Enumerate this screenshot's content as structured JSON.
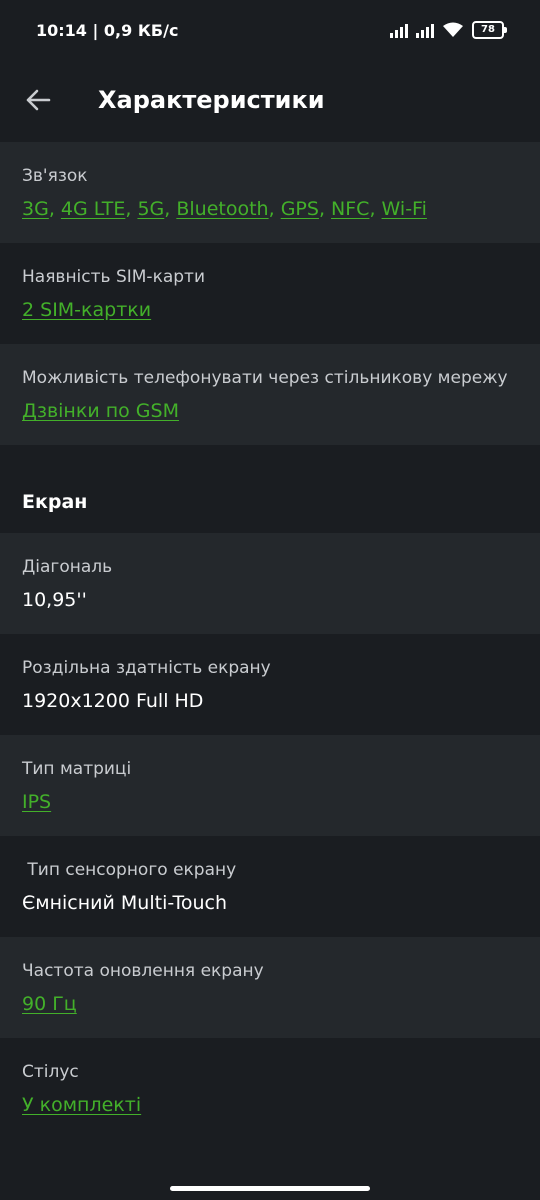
{
  "status_bar": {
    "time_speed": "10:14 | 0,9 КБ/с",
    "battery": "78"
  },
  "header": {
    "title": "Характеристики"
  },
  "connection": {
    "label": "Зв'язок",
    "links": [
      "3G",
      "4G LTE",
      "5G",
      "Bluetooth",
      "GPS",
      "NFC",
      "Wi-Fi"
    ]
  },
  "sim": {
    "label": "Наявність SIM-карти",
    "value": "2 SIM-картки"
  },
  "calls": {
    "label": "Можливість телефонувати через стільникову мережу",
    "value": "Дзвінки по GSM"
  },
  "screen_section": {
    "title": "Екран"
  },
  "diagonal": {
    "label": "Діагональ",
    "value": "10,95''"
  },
  "resolution": {
    "label": "Роздільна здатність екрану",
    "value": "1920x1200 Full HD"
  },
  "matrix": {
    "label": "Тип матриці",
    "value": "IPS"
  },
  "touch": {
    "label": " Тип сенсорного екрану",
    "value": "Ємнісний Multi-Touch"
  },
  "refresh": {
    "label": "Частота оновлення екрану",
    "value": "90 Гц"
  },
  "stylus": {
    "label": "Стілус",
    "value": "У комплекті"
  },
  "colors": {
    "background": "#1a1d21",
    "alt_row": "#24282c",
    "link": "#43b02a"
  },
  "icons": {
    "back": "arrow-left-icon",
    "signal": "signal-icon",
    "wifi": "wifi-icon",
    "battery": "battery-icon"
  }
}
